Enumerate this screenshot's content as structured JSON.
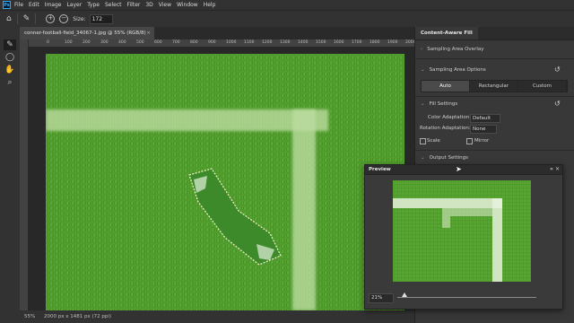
{
  "menubar": {
    "logo": "Ps",
    "items": [
      "File",
      "Edit",
      "Image",
      "Layer",
      "Type",
      "Select",
      "Filter",
      "3D",
      "View",
      "Window",
      "Help"
    ]
  },
  "options": {
    "size_label": "Size:",
    "size_value": "172",
    "add_symbol": "+",
    "subtract_symbol": "−"
  },
  "document": {
    "tab_title": "conner-football-field_34067-1.jpg @ 55% (RGB/8)",
    "tab_close": "×",
    "ruler_ticks": [
      "0",
      "100",
      "200",
      "300",
      "400",
      "500",
      "600",
      "700",
      "800",
      "900",
      "1000",
      "1100",
      "1200",
      "1300",
      "1400",
      "1500",
      "1600",
      "1700",
      "1800",
      "1900",
      "2000"
    ]
  },
  "status": {
    "zoom": "55%",
    "dimensions": "2000 px x 1481 px (72 ppi)"
  },
  "panel": {
    "title": "Content-Aware Fill",
    "sampling_overlay": "Sampling Area Overlay",
    "sampling_options": "Sampling Area Options",
    "sampling_modes": [
      "Auto",
      "Rectangular",
      "Custom"
    ],
    "sampling_selected": "Auto",
    "fill_settings": "Fill Settings",
    "color_adaptation_label": "Color Adaptation:",
    "color_adaptation_value": "Default",
    "rotation_adaptation_label": "Rotation Adaptation:",
    "rotation_adaptation_value": "None",
    "scale_label": "Scale",
    "mirror_label": "Mirror",
    "output_settings": "Output Settings"
  },
  "preview": {
    "title": "Preview",
    "zoom": "21%",
    "zoom_fraction": 0.05
  },
  "colors": {
    "accent": "#31a8ff",
    "grass": "#4f9a2c",
    "line": "#d9e8c8"
  }
}
